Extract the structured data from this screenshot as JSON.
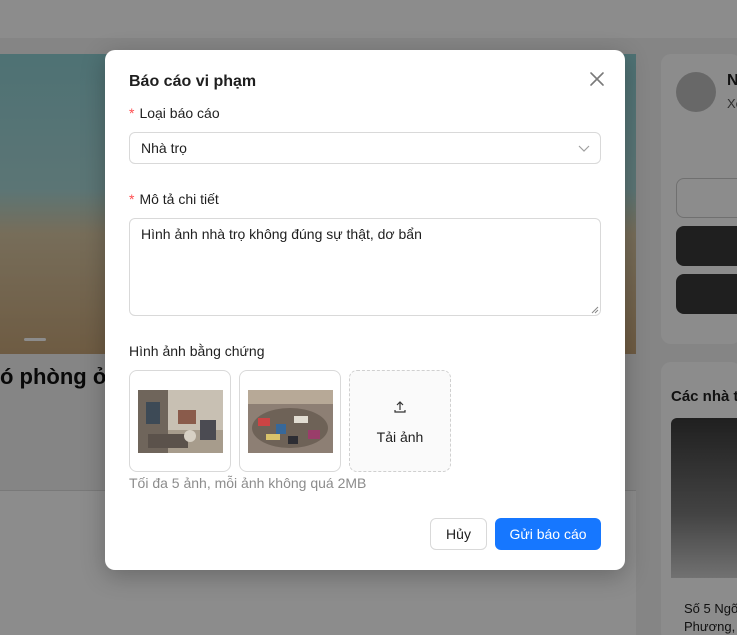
{
  "background": {
    "listing_title": "ó phòng ở",
    "owner_name": "N",
    "owner_sub": "Xe",
    "section_title": "Các nhà t",
    "address_line1": "Số 5 Ngõ",
    "address_line2": "Phương,"
  },
  "modal": {
    "title": "Báo cáo vi phạm",
    "report_type": {
      "label": "Loại báo cáo",
      "required_mark": "*",
      "selected": "Nhà trọ"
    },
    "description": {
      "label": "Mô tả chi tiết",
      "required_mark": "*",
      "value": "Hình ảnh nhà trọ không đúng sự thật, dơ bẩn"
    },
    "evidence": {
      "label": "Hình ảnh bằng chứng",
      "upload_label": "Tải ảnh",
      "hint": "Tối đa 5 ảnh, mỗi ảnh không quá 2MB"
    },
    "buttons": {
      "cancel": "Hủy",
      "submit": "Gửi báo cáo"
    },
    "colors": {
      "primary": "#1677ff",
      "required": "#ff4d4f"
    }
  }
}
